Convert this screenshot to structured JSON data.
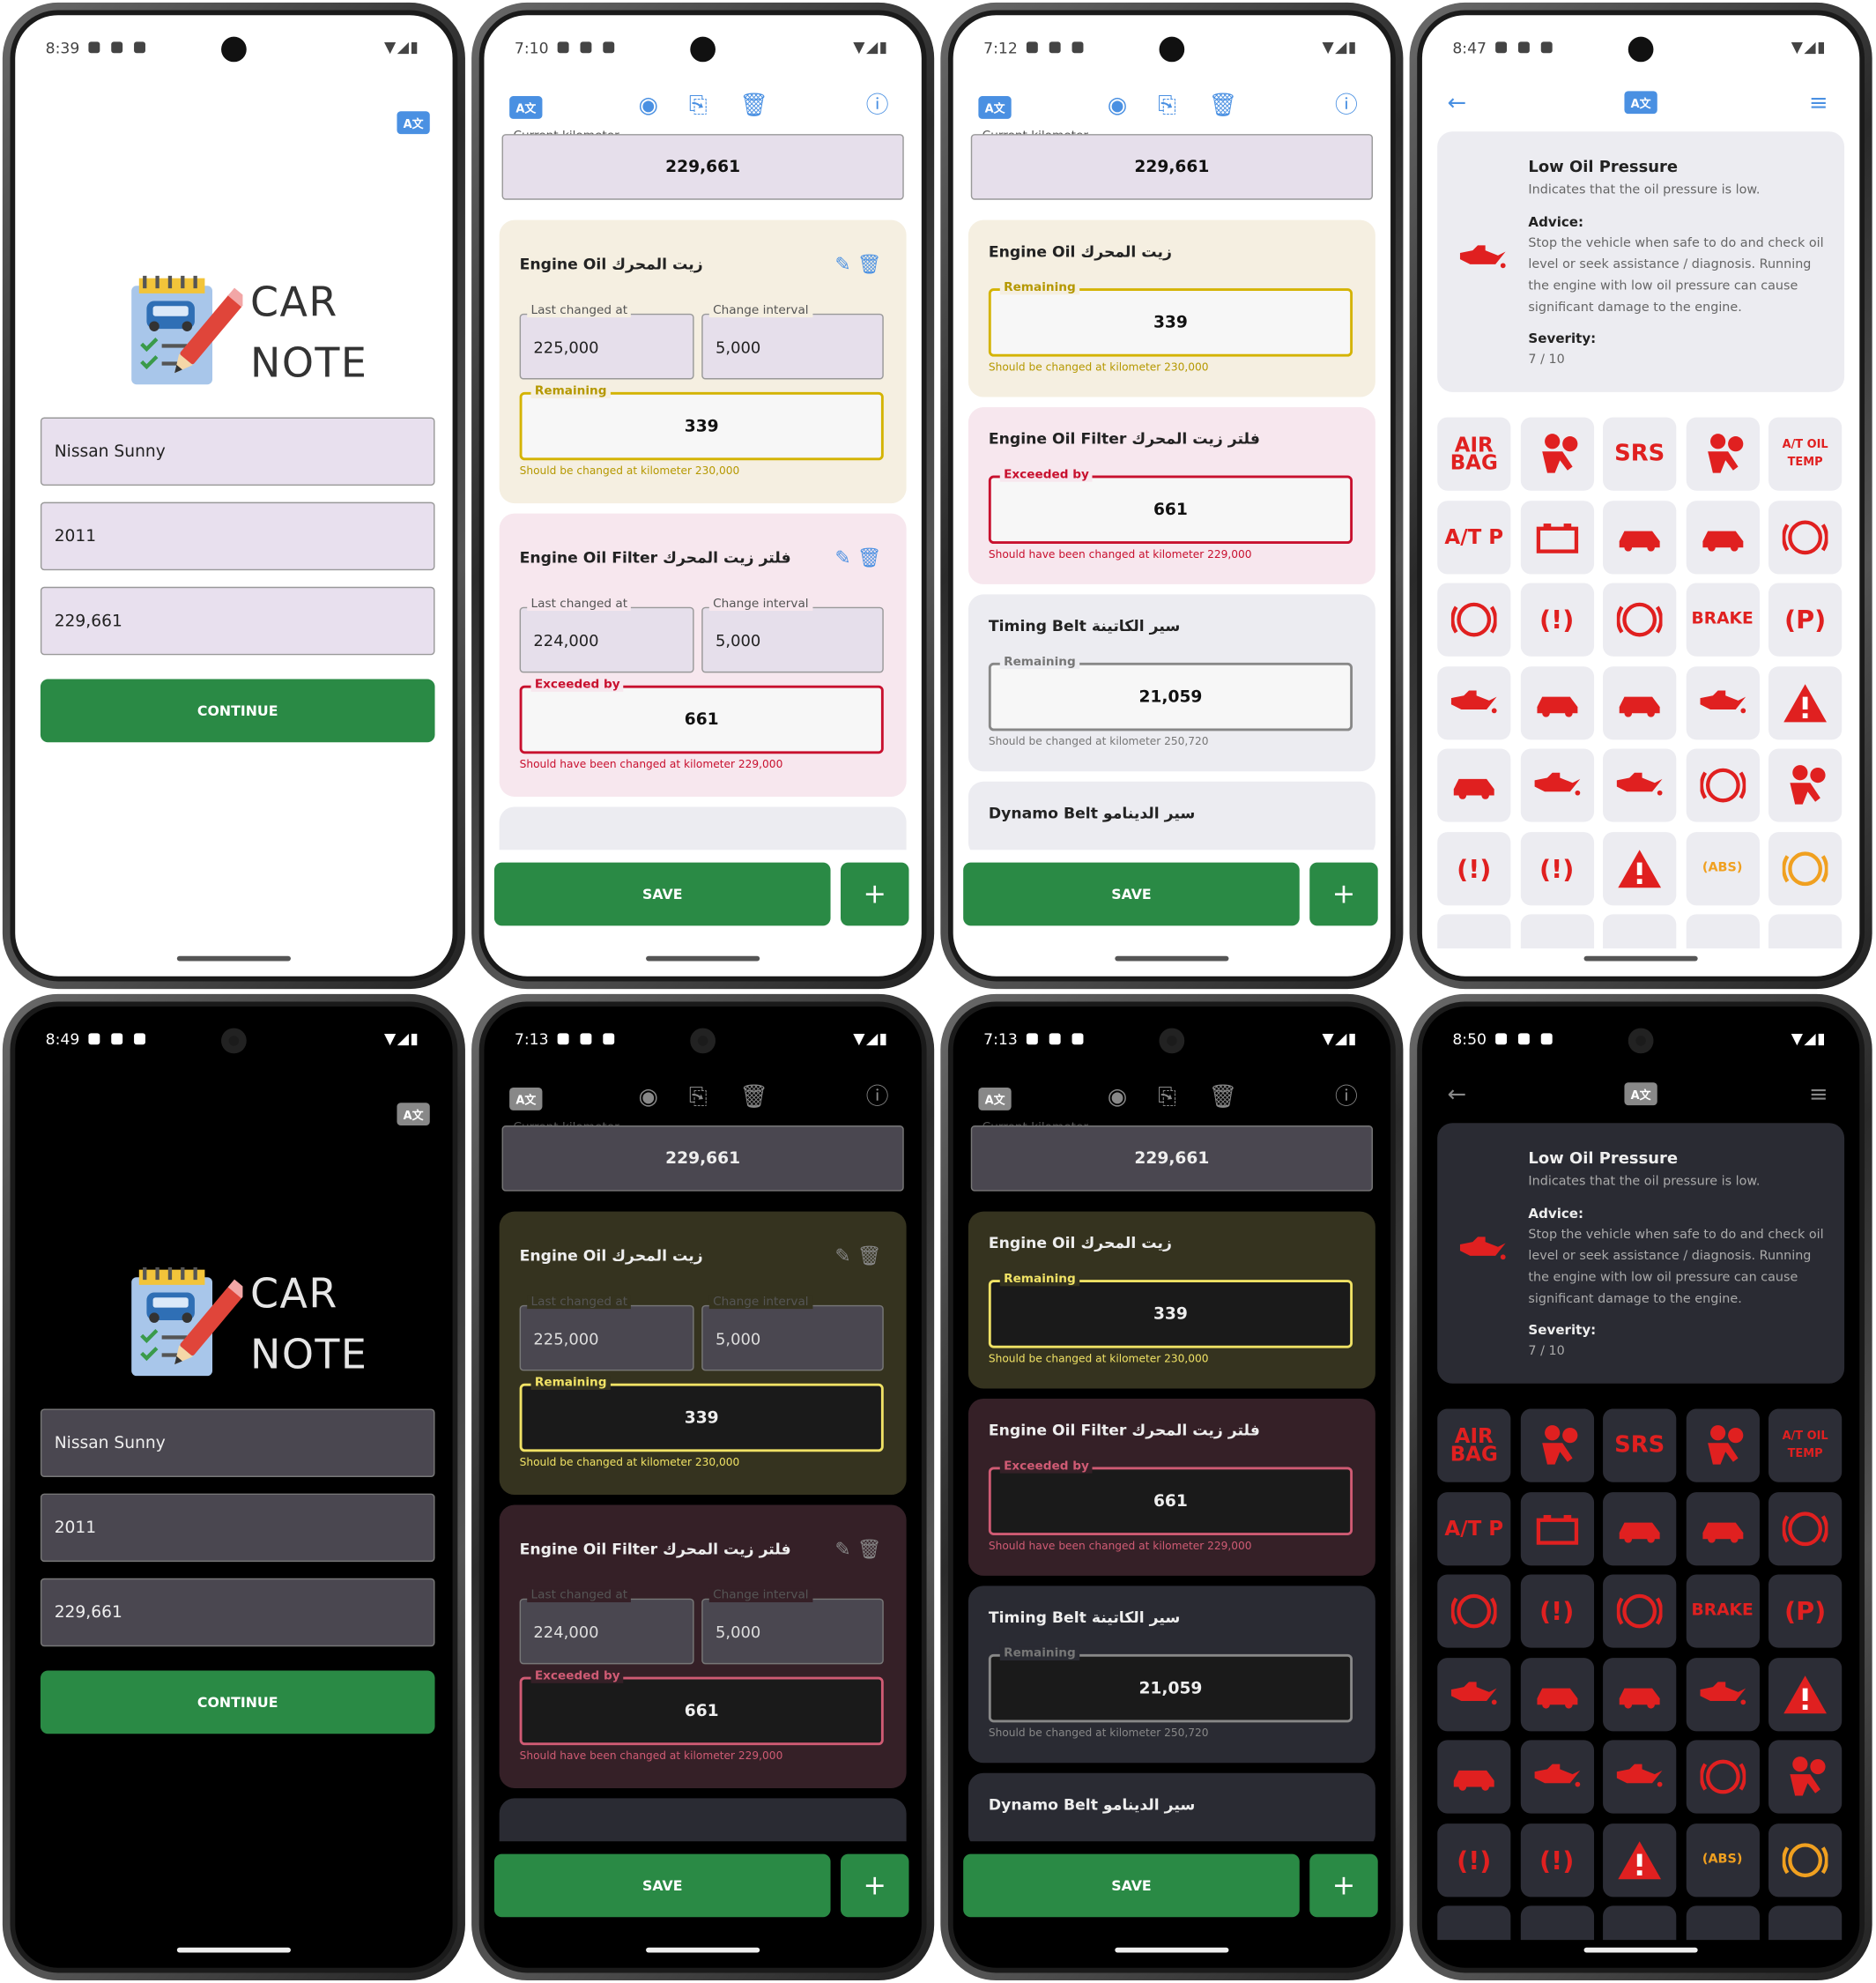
{
  "times": [
    "8:39",
    "7:10",
    "7:12",
    "8:47",
    "8:49",
    "7:13",
    "7:13",
    "8:50"
  ],
  "login": {
    "logo_line1": "CAR",
    "logo_line2": "NOTE",
    "car_name": "Nissan Sunny",
    "year": "2011",
    "kilometer": "229,661",
    "continue": "CONTINUE"
  },
  "translate_label": "A文",
  "icons": {
    "translate": "translate-icon",
    "eye": "eye-icon",
    "copy": "copy-icon",
    "clear": "clear-icon",
    "info": "info-icon",
    "edit": "edit-icon",
    "delete": "delete-icon",
    "back": "back-arrow-icon",
    "sort": "sort-icon"
  },
  "current_km": {
    "label": "Current kilometer",
    "value": "229,661"
  },
  "items": {
    "engine_oil": {
      "title": "Engine Oil  زيت المحرك",
      "last_label": "Last changed at",
      "last": "225,000",
      "interval_label": "Change interval",
      "interval": "5,000",
      "status_label": "Remaining",
      "status": "339",
      "note": "Should be changed at kilometer 230,000"
    },
    "oil_filter": {
      "title": "Engine Oil Filter  فلتر زيت المحرك",
      "last_label": "Last changed at",
      "last": "224,000",
      "interval_label": "Change interval",
      "interval": "5,000",
      "status_label": "Exceeded by",
      "status": "661",
      "note": "Should have been changed at kilometer 229,000"
    },
    "timing_belt": {
      "title": "Timing Belt  سير الكاتينة",
      "status_label": "Remaining",
      "status": "21,059",
      "note": "Should be changed at kilometer 250,720"
    },
    "dynamo_belt": {
      "title": "Dynamo Belt  سير الدينامو"
    }
  },
  "save": "SAVE",
  "add": "+",
  "warning": {
    "title": "Low Oil Pressure",
    "desc": "Indicates that the oil pressure is low.",
    "advice_label": "Advice:",
    "advice": "Stop the vehicle when safe to do and check oil level or seek assistance / diagnosis. Running the engine with low oil pressure can cause significant damage to the engine.",
    "severity_label": "Severity:",
    "severity": "7 / 10"
  },
  "tiles": [
    "AIR BAG",
    "",
    "SRS",
    "",
    "A/T OIL TEMP",
    "A/T P",
    "",
    "",
    "",
    "",
    "",
    "",
    "",
    "BRAKE",
    "(P)",
    "",
    "",
    "",
    "",
    "",
    "",
    "",
    "",
    "",
    "",
    "",
    "",
    "",
    "(ABS)",
    ""
  ]
}
